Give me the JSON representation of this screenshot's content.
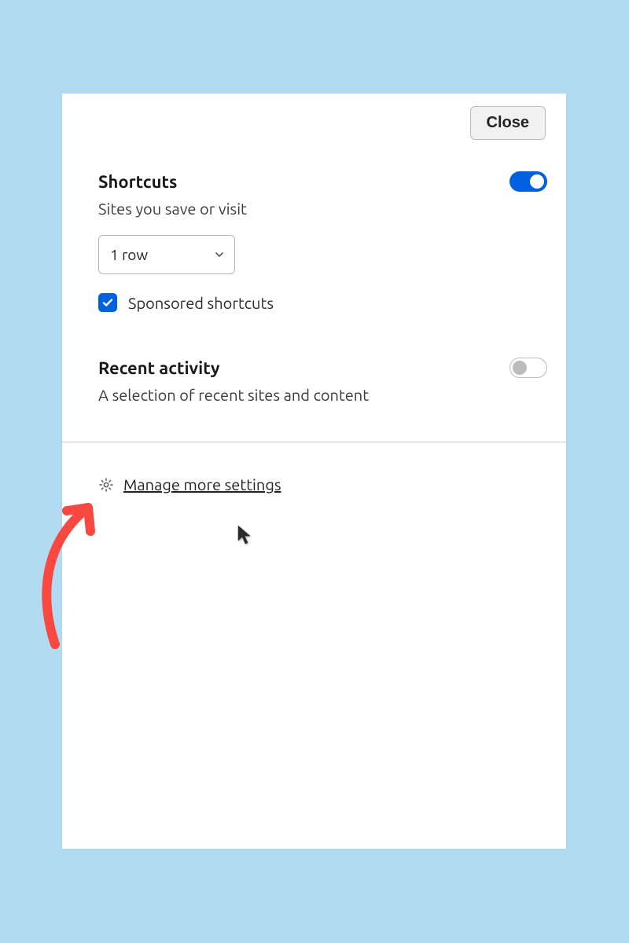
{
  "close_label": "Close",
  "shortcuts": {
    "title": "Shortcuts",
    "subtitle": "Sites you save or visit",
    "toggle_on": true,
    "rows_selected": "1 row",
    "sponsored_label": "Sponsored shortcuts",
    "sponsored_checked": true
  },
  "recent": {
    "title": "Recent activity",
    "subtitle": "A selection of recent sites and content",
    "toggle_on": false
  },
  "manage_label": "Manage more settings",
  "colors": {
    "accent": "#0061e0",
    "annotation": "#f8483f"
  }
}
